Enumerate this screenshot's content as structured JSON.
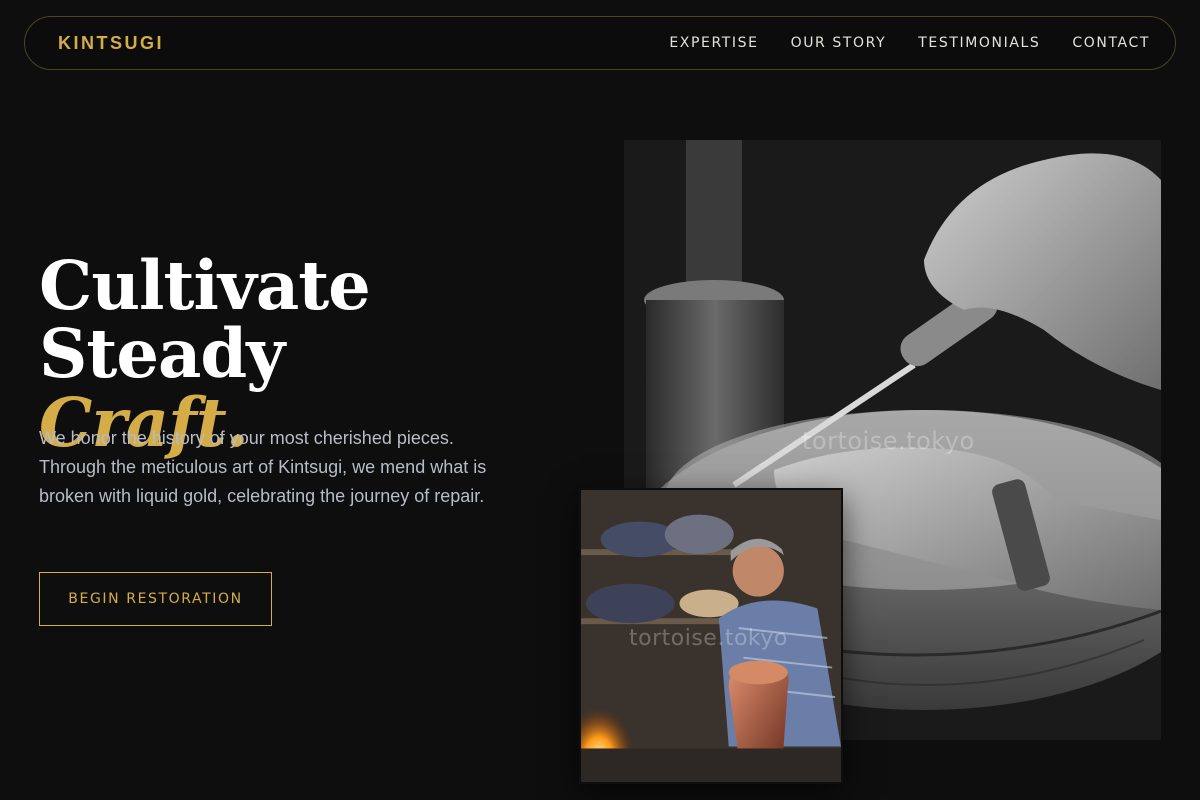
{
  "nav": {
    "brand": "KINTSUGI",
    "links": [
      "EXPERTISE",
      "OUR STORY",
      "TESTIMONIALS",
      "CONTACT"
    ]
  },
  "hero": {
    "title_line1": "Cultivate Steady",
    "title_accent": "Craft.",
    "description": "We honor the history of your most cherished pieces. Through the meticulous art of Kintsugi, we mend what is broken with liquid gold, celebrating the journey of repair.",
    "cta_label": "BEGIN RESTORATION"
  },
  "images": {
    "main_watermark": "tortoise.tokyo",
    "second_watermark": "tortoise.tokyo"
  },
  "colors": {
    "background": "#0e0e0f",
    "accent_gold": "#d4ad48",
    "text_muted": "#b7bcc6"
  }
}
